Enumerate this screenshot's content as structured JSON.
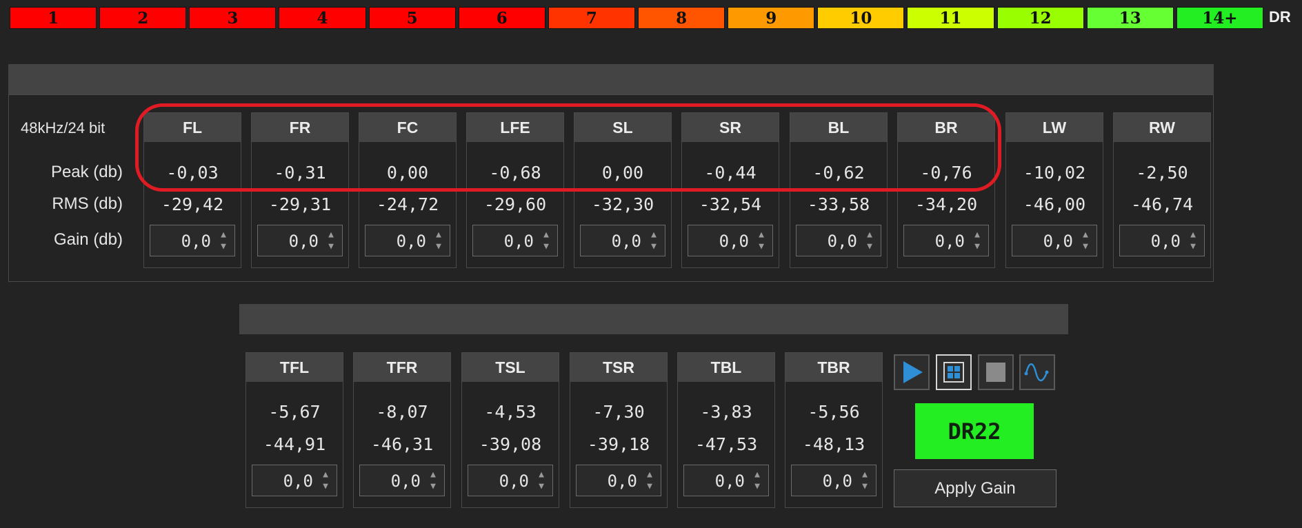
{
  "dr_scale": {
    "cells": [
      {
        "label": "1",
        "color": "#ff0000"
      },
      {
        "label": "2",
        "color": "#ff0000"
      },
      {
        "label": "3",
        "color": "#ff0000"
      },
      {
        "label": "4",
        "color": "#ff0000"
      },
      {
        "label": "5",
        "color": "#ff0000"
      },
      {
        "label": "6",
        "color": "#ff0000"
      },
      {
        "label": "7",
        "color": "#ff3300"
      },
      {
        "label": "8",
        "color": "#ff5500"
      },
      {
        "label": "9",
        "color": "#ff9900"
      },
      {
        "label": "10",
        "color": "#ffcc00"
      },
      {
        "label": "11",
        "color": "#ccff00"
      },
      {
        "label": "12",
        "color": "#99ff00"
      },
      {
        "label": "13",
        "color": "#66ff33"
      },
      {
        "label": "14+",
        "color": "#22ee22"
      }
    ],
    "tag": "DR"
  },
  "format": "48kHz/24 bit",
  "row_labels": {
    "peak": "Peak (db)",
    "rms": "RMS (db)",
    "gain": "Gain (db)"
  },
  "main_channels": [
    {
      "name": "FL",
      "peak": "-0,03",
      "rms": "-29,42",
      "gain": "0,0"
    },
    {
      "name": "FR",
      "peak": "-0,31",
      "rms": "-29,31",
      "gain": "0,0"
    },
    {
      "name": "FC",
      "peak": "0,00",
      "rms": "-24,72",
      "gain": "0,0"
    },
    {
      "name": "LFE",
      "peak": "-0,68",
      "rms": "-29,60",
      "gain": "0,0"
    },
    {
      "name": "SL",
      "peak": "0,00",
      "rms": "-32,30",
      "gain": "0,0"
    },
    {
      "name": "SR",
      "peak": "-0,44",
      "rms": "-32,54",
      "gain": "0,0"
    },
    {
      "name": "BL",
      "peak": "-0,62",
      "rms": "-33,58",
      "gain": "0,0"
    },
    {
      "name": "BR",
      "peak": "-0,76",
      "rms": "-34,20",
      "gain": "0,0"
    },
    {
      "name": "LW",
      "peak": "-10,02",
      "rms": "-46,00",
      "gain": "0,0"
    },
    {
      "name": "RW",
      "peak": "-2,50",
      "rms": "-46,74",
      "gain": "0,0"
    }
  ],
  "top_channels": [
    {
      "name": "TFL",
      "peak": "-5,67",
      "rms": "-44,91",
      "gain": "0,0"
    },
    {
      "name": "TFR",
      "peak": "-8,07",
      "rms": "-46,31",
      "gain": "0,0"
    },
    {
      "name": "TSL",
      "peak": "-4,53",
      "rms": "-39,08",
      "gain": "0,0"
    },
    {
      "name": "TSR",
      "peak": "-7,30",
      "rms": "-39,18",
      "gain": "0,0"
    },
    {
      "name": "TBL",
      "peak": "-3,83",
      "rms": "-47,53",
      "gain": "0,0"
    },
    {
      "name": "TBR",
      "peak": "-5,56",
      "rms": "-48,13",
      "gain": "0,0"
    }
  ],
  "controls": {
    "icons": [
      "play-icon",
      "grid-icon",
      "stop-icon",
      "waveform-icon"
    ],
    "accent_color": "#2e8fd6"
  },
  "dr_result": "DR22",
  "apply_gain_label": "Apply Gain"
}
